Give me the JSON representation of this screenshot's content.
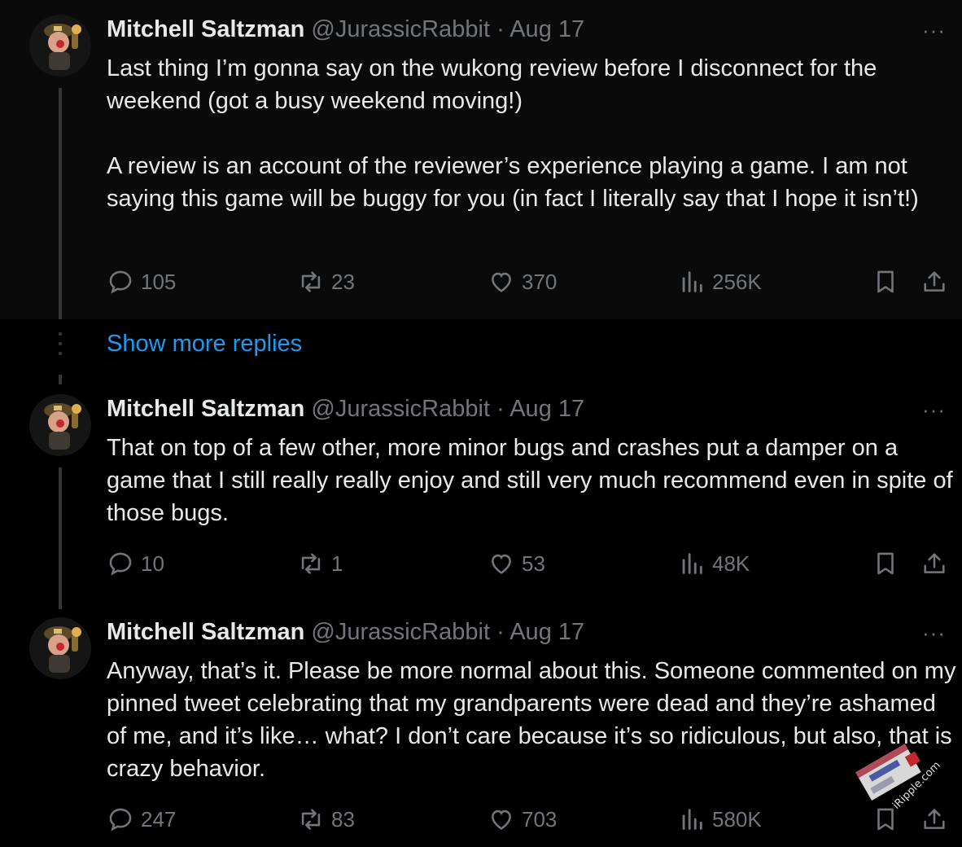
{
  "tweets": [
    {
      "name": "Mitchell Saltzman",
      "handle": "@JurassicRabbit",
      "separator": "·",
      "date": "Aug 17",
      "text": "Last thing I’m gonna say on the wukong review before I disconnect for the weekend (got a busy weekend moving!)\n\nA review is an account of the reviewer’s experience playing a game. I am not saying this game will be buggy for you (in fact I literally say that I hope it isn’t!)",
      "replies": "105",
      "retweets": "23",
      "likes": "370",
      "views": "256K"
    },
    {
      "name": "Mitchell Saltzman",
      "handle": "@JurassicRabbit",
      "separator": "·",
      "date": "Aug 17",
      "text": "That on top of a few other, more minor bugs and crashes put a damper on a game that I still really really enjoy and still very much recommend even in spite of those bugs.",
      "replies": "10",
      "retweets": "1",
      "likes": "53",
      "views": "48K"
    },
    {
      "name": "Mitchell Saltzman",
      "handle": "@JurassicRabbit",
      "separator": "·",
      "date": "Aug 17",
      "text": "Anyway, that’s it. Please be more normal about this. Someone commented on my pinned tweet celebrating that my grandparents were dead and they’re ashamed of me, and it’s like… what? I don’t care because it’s so ridiculous, but also, that is crazy behavior.",
      "replies": "247",
      "retweets": "83",
      "likes": "703",
      "views": "580K"
    }
  ],
  "show_more_replies": "Show more replies",
  "more_menu": "···",
  "watermark_text": "iRipple.com",
  "colors": {
    "background": "#000000",
    "text": "#e7e9ea",
    "muted": "#71767b",
    "link": "#1d9bf0",
    "thread_line": "#333639"
  },
  "icons": [
    "reply-icon",
    "retweet-icon",
    "like-icon",
    "views-icon",
    "bookmark-icon",
    "share-icon",
    "more-icon"
  ]
}
